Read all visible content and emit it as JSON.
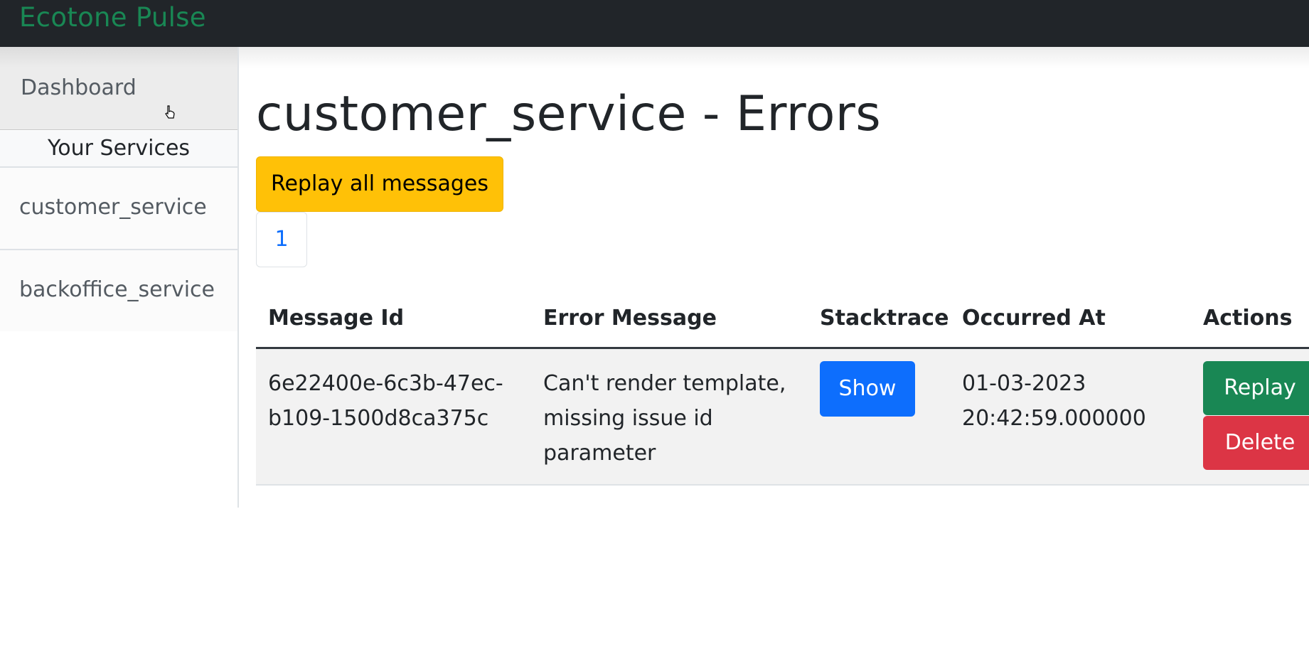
{
  "navbar": {
    "brand": "Ecotone Pulse"
  },
  "sidebar": {
    "dashboard_label": "Dashboard",
    "services_header": "Your Services",
    "services": [
      {
        "label": "customer_service"
      },
      {
        "label": "backoffice_service"
      }
    ]
  },
  "main": {
    "title": "customer_service - Errors",
    "replay_all_label": "Replay all messages",
    "pagination": {
      "current_page": "1"
    },
    "table": {
      "headers": [
        "Message Id",
        "Error Message",
        "Stacktrace",
        "Occurred At",
        "Actions"
      ],
      "rows": [
        {
          "message_id_line1": "6e22400e-6c3b-47ec-",
          "message_id_line2": "b109-1500d8ca375c",
          "error_line1": "Can't render template,",
          "error_line2": "missing issue id",
          "error_line3": "parameter",
          "show_label": "Show",
          "occurred_line1": "01-03-2023",
          "occurred_line2": "20:42:59.000000",
          "replay_label": "Replay",
          "delete_label": "Delete"
        }
      ]
    }
  },
  "colors": {
    "navbar_bg": "#212529",
    "brand": "#198754",
    "warning": "#ffc107",
    "primary": "#0d6efd",
    "success": "#198754",
    "danger": "#dc3545"
  },
  "icons": {
    "cursor": "hand-pointer-icon"
  }
}
